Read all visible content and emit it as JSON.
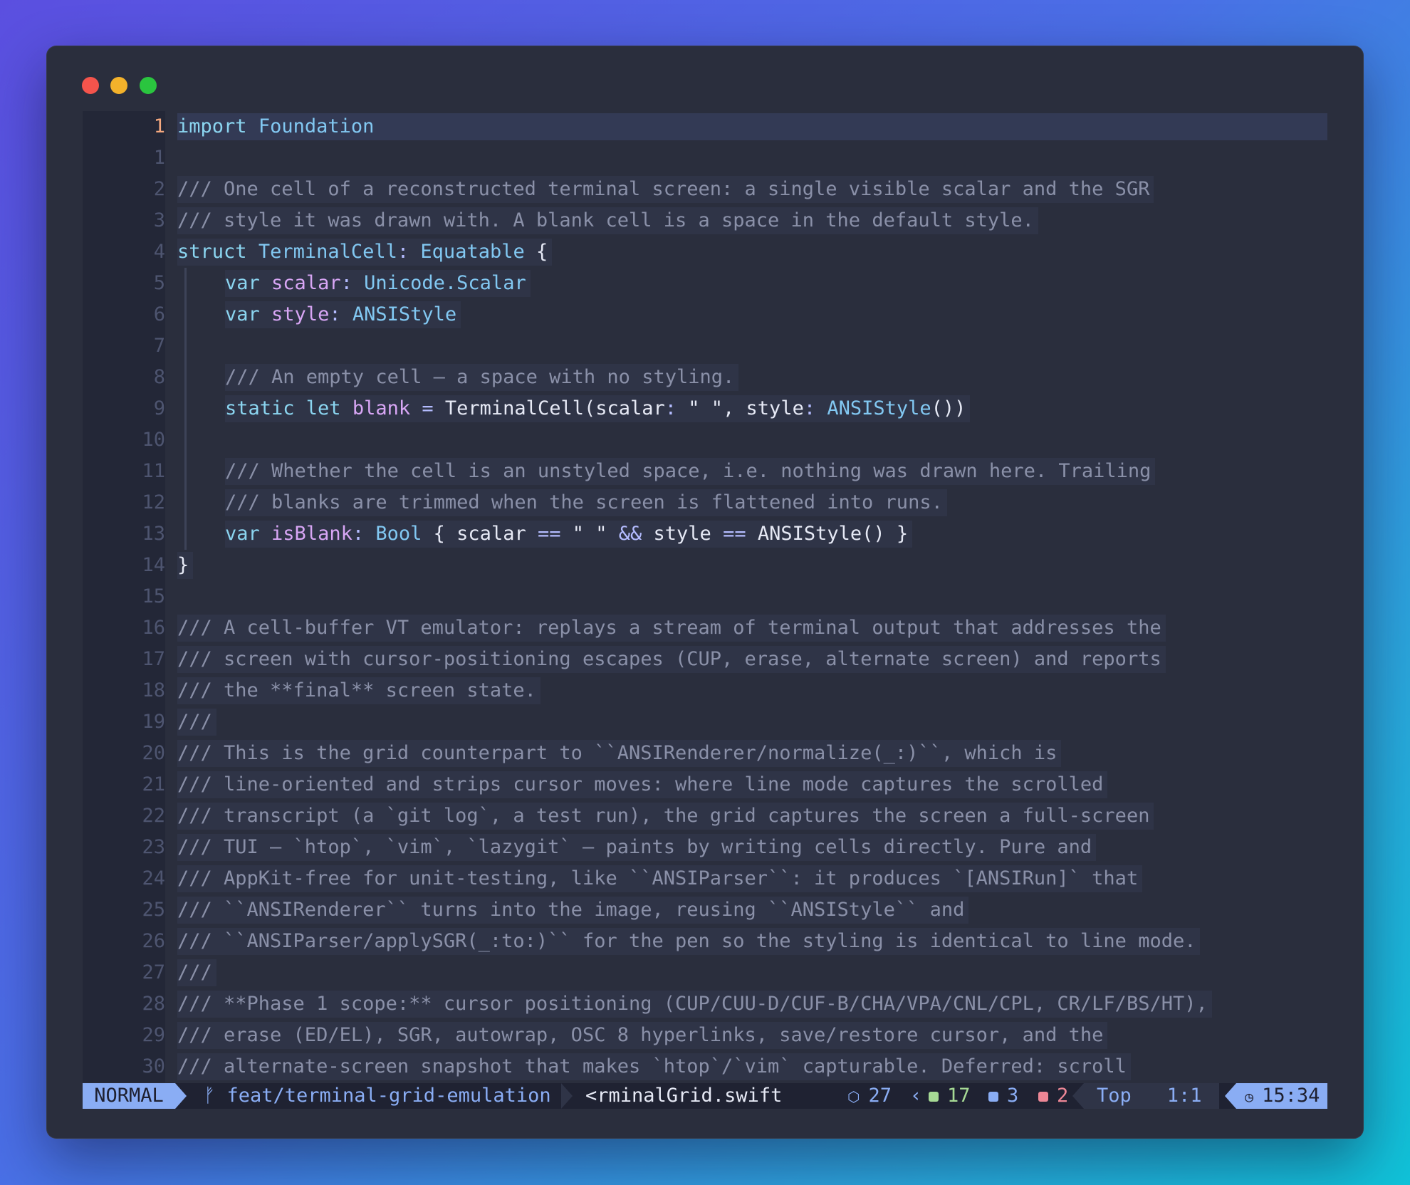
{
  "window": {
    "traffic_lights": [
      "close",
      "minimize",
      "zoom"
    ]
  },
  "editor": {
    "lines": [
      {
        "num": "1",
        "current": true,
        "indent": 0,
        "parts": [
          [
            "kw",
            "import"
          ],
          [
            "str",
            " "
          ],
          [
            "ty",
            "Foundation"
          ]
        ]
      },
      {
        "num": "1",
        "indent": 0,
        "parts": []
      },
      {
        "num": "2",
        "indent": 0,
        "parts": [
          [
            "cm",
            "/// One cell of a reconstructed terminal screen: a single visible scalar and the SGR"
          ]
        ]
      },
      {
        "num": "3",
        "indent": 0,
        "parts": [
          [
            "cm",
            "/// style it was drawn with. A blank cell is a space in the default style."
          ]
        ]
      },
      {
        "num": "4",
        "indent": 0,
        "parts": [
          [
            "kw",
            "struct"
          ],
          [
            "str",
            " "
          ],
          [
            "ty",
            "TerminalCell"
          ],
          [
            "op",
            ":"
          ],
          [
            "str",
            " "
          ],
          [
            "ty",
            "Equatable"
          ],
          [
            "str",
            " {"
          ]
        ]
      },
      {
        "num": "5",
        "indent": 1,
        "parts": [
          [
            "kw",
            "var"
          ],
          [
            "str",
            " "
          ],
          [
            "prop",
            "scalar"
          ],
          [
            "op",
            ":"
          ],
          [
            "str",
            " "
          ],
          [
            "ty",
            "Unicode.Scalar"
          ]
        ]
      },
      {
        "num": "6",
        "indent": 1,
        "parts": [
          [
            "kw",
            "var"
          ],
          [
            "str",
            " "
          ],
          [
            "prop",
            "style"
          ],
          [
            "op",
            ":"
          ],
          [
            "str",
            " "
          ],
          [
            "ty",
            "ANSIStyle"
          ]
        ]
      },
      {
        "num": "7",
        "indent": 1,
        "parts": []
      },
      {
        "num": "8",
        "indent": 1,
        "parts": [
          [
            "cm",
            "/// An empty cell — a space with no styling."
          ]
        ]
      },
      {
        "num": "9",
        "indent": 1,
        "parts": [
          [
            "kw",
            "static let"
          ],
          [
            "str",
            " "
          ],
          [
            "prop",
            "blank"
          ],
          [
            "str",
            " "
          ],
          [
            "op",
            "="
          ],
          [
            "str",
            " TerminalCell(scalar"
          ],
          [
            "op",
            ":"
          ],
          [
            "str",
            " \" \", style"
          ],
          [
            "op",
            ":"
          ],
          [
            "str",
            " "
          ],
          [
            "ty",
            "ANSIStyle"
          ],
          [
            "str",
            "())"
          ]
        ]
      },
      {
        "num": "10",
        "indent": 1,
        "parts": []
      },
      {
        "num": "11",
        "indent": 1,
        "parts": [
          [
            "cm",
            "/// Whether the cell is an unstyled space, i.e. nothing was drawn here. Trailing"
          ]
        ]
      },
      {
        "num": "12",
        "indent": 1,
        "parts": [
          [
            "cm",
            "/// blanks are trimmed when the screen is flattened into runs."
          ]
        ]
      },
      {
        "num": "13",
        "indent": 1,
        "parts": [
          [
            "kw",
            "var"
          ],
          [
            "str",
            " "
          ],
          [
            "prop",
            "isBlank"
          ],
          [
            "op",
            ":"
          ],
          [
            "str",
            " "
          ],
          [
            "ty",
            "Bool"
          ],
          [
            "str",
            " { scalar "
          ],
          [
            "op",
            "=="
          ],
          [
            "str",
            " \" \" "
          ],
          [
            "op",
            "&&"
          ],
          [
            "str",
            " style "
          ],
          [
            "op",
            "=="
          ],
          [
            "str",
            " ANSIStyle() }"
          ]
        ]
      },
      {
        "num": "14",
        "indent": 0,
        "parts": [
          [
            "str",
            "}"
          ]
        ]
      },
      {
        "num": "15",
        "indent": 0,
        "parts": []
      },
      {
        "num": "16",
        "indent": 0,
        "parts": [
          [
            "cm",
            "/// A cell-buffer VT emulator: replays a stream of terminal output that addresses the"
          ]
        ]
      },
      {
        "num": "17",
        "indent": 0,
        "parts": [
          [
            "cm",
            "/// screen with cursor-positioning escapes (CUP, erase, alternate screen) and reports"
          ]
        ]
      },
      {
        "num": "18",
        "indent": 0,
        "parts": [
          [
            "cm",
            "/// the **final** screen state."
          ]
        ]
      },
      {
        "num": "19",
        "indent": 0,
        "parts": [
          [
            "cm",
            "///"
          ]
        ]
      },
      {
        "num": "20",
        "indent": 0,
        "parts": [
          [
            "cm",
            "/// This is the grid counterpart to ``ANSIRenderer/normalize(_:)``, which is"
          ]
        ]
      },
      {
        "num": "21",
        "indent": 0,
        "parts": [
          [
            "cm",
            "/// line-oriented and strips cursor moves: where line mode captures the scrolled"
          ]
        ]
      },
      {
        "num": "22",
        "indent": 0,
        "parts": [
          [
            "cm",
            "/// transcript (a `git log`, a test run), the grid captures the screen a full-screen"
          ]
        ]
      },
      {
        "num": "23",
        "indent": 0,
        "parts": [
          [
            "cm",
            "/// TUI — `htop`, `vim`, `lazygit` — paints by writing cells directly. Pure and"
          ]
        ]
      },
      {
        "num": "24",
        "indent": 0,
        "parts": [
          [
            "cm",
            "/// AppKit-free for unit-testing, like ``ANSIParser``: it produces `[ANSIRun]` that"
          ]
        ]
      },
      {
        "num": "25",
        "indent": 0,
        "parts": [
          [
            "cm",
            "/// ``ANSIRenderer`` turns into the image, reusing ``ANSIStyle`` and"
          ]
        ]
      },
      {
        "num": "26",
        "indent": 0,
        "parts": [
          [
            "cm",
            "/// ``ANSIParser/applySGR(_:to:)`` for the pen so the styling is identical to line mode."
          ]
        ]
      },
      {
        "num": "27",
        "indent": 0,
        "parts": [
          [
            "cm",
            "///"
          ]
        ]
      },
      {
        "num": "28",
        "indent": 0,
        "parts": [
          [
            "cm",
            "/// **Phase 1 scope:** cursor positioning (CUP/CUU-D/CUF-B/CHA/VPA/CNL/CPL, CR/LF/BS/HT),"
          ]
        ]
      },
      {
        "num": "29",
        "indent": 0,
        "parts": [
          [
            "cm",
            "/// erase (ED/EL), SGR, autowrap, OSC 8 hyperlinks, save/restore cursor, and the"
          ]
        ]
      },
      {
        "num": "30",
        "indent": 0,
        "parts": [
          [
            "cm",
            "/// alternate-screen snapshot that makes `htop`/`vim` capturable. Deferred: scroll"
          ]
        ]
      }
    ]
  },
  "status": {
    "mode": "NORMAL",
    "branch_icon": "git-branch-icon",
    "branch": "feat/terminal-grid-emulation",
    "file": "<rminalGrid.swift",
    "package_icon": "package-icon",
    "package_count": "27",
    "added": "17",
    "modified": "3",
    "removed": "2",
    "position": "Top",
    "cursor": "1:1",
    "clock_icon": "clock-icon",
    "time": "15:34",
    "colors": {
      "added": "#a6da95",
      "modified": "#8aadf4",
      "removed": "#ed8796",
      "accent": "#8aadf4"
    }
  }
}
